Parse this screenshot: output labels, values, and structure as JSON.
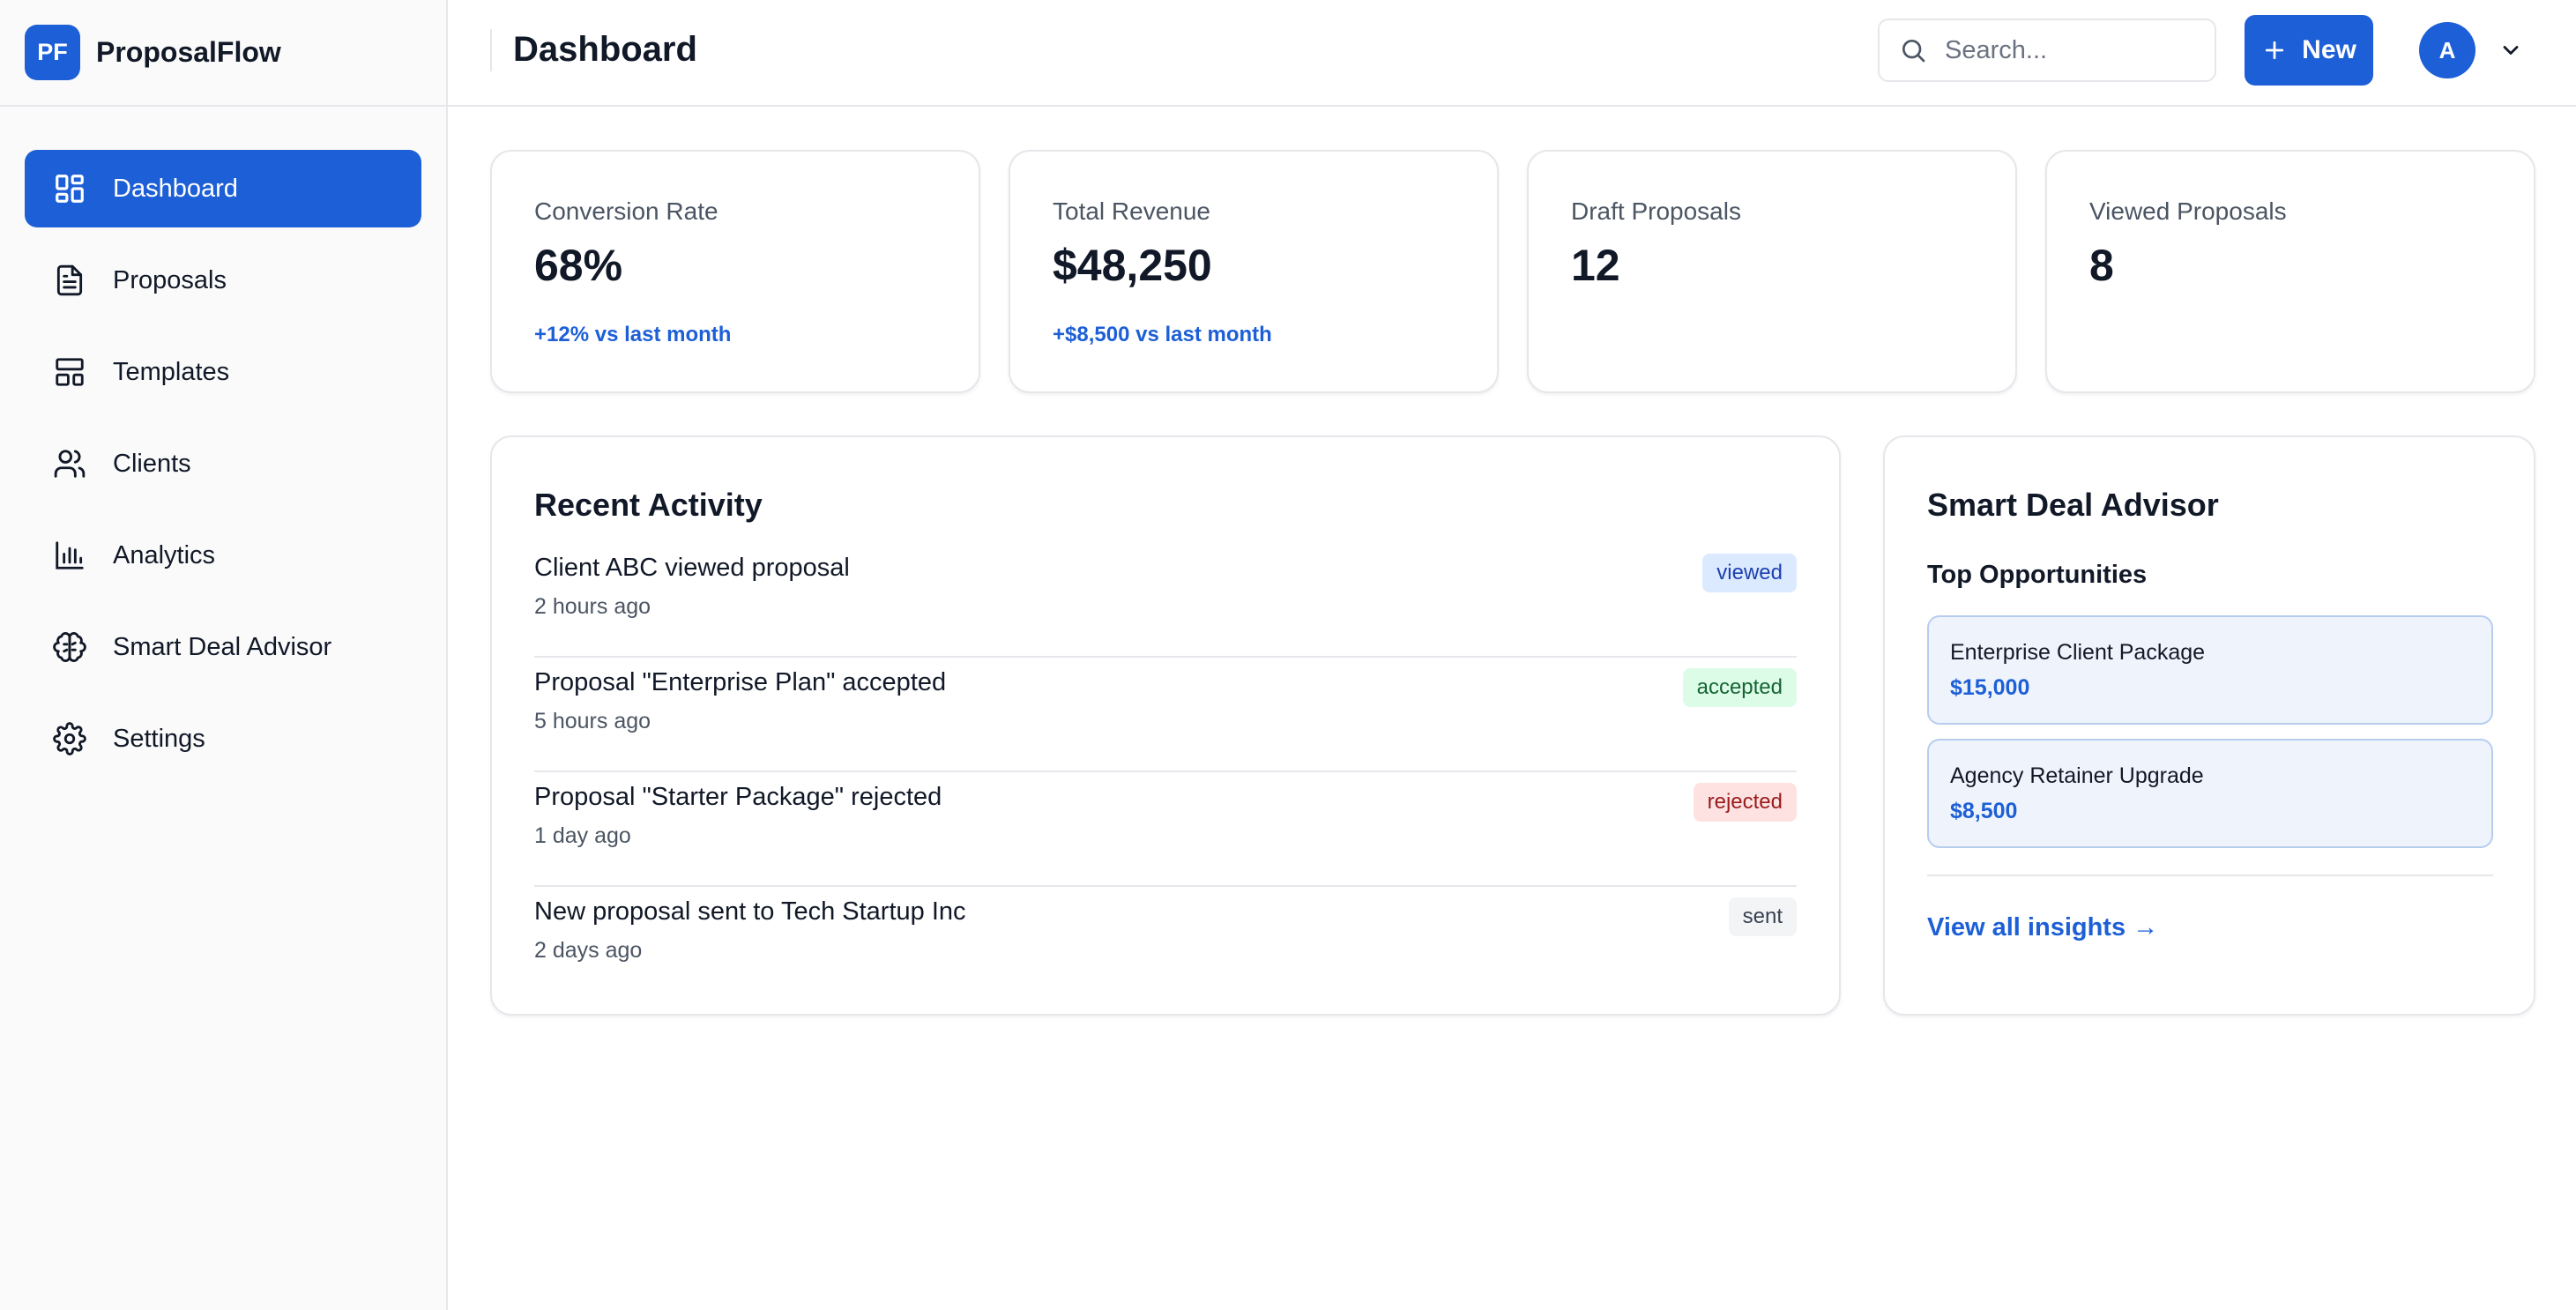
{
  "brand": {
    "logo_text": "PF",
    "name": "ProposalFlow"
  },
  "colors": {
    "accent": "#1d5fd6",
    "sidebar_bg": "#fafafa",
    "border": "#e5e7eb"
  },
  "sidebar": {
    "items": [
      {
        "label": "Dashboard",
        "icon": "dashboard-grid-icon",
        "active": true
      },
      {
        "label": "Proposals",
        "icon": "document-icon",
        "active": false
      },
      {
        "label": "Templates",
        "icon": "template-layout-icon",
        "active": false
      },
      {
        "label": "Clients",
        "icon": "users-icon",
        "active": false
      },
      {
        "label": "Analytics",
        "icon": "bar-chart-icon",
        "active": false
      },
      {
        "label": "Smart Deal Advisor",
        "icon": "brain-icon",
        "active": false
      },
      {
        "label": "Settings",
        "icon": "gear-icon",
        "active": false
      }
    ]
  },
  "header": {
    "title": "Dashboard",
    "search": {
      "placeholder": "Search...",
      "value": ""
    },
    "new_button": "New",
    "avatar_initial": "A"
  },
  "stats": [
    {
      "label": "Conversion Rate",
      "value": "68%",
      "trend": "+12% vs last month"
    },
    {
      "label": "Total Revenue",
      "value": "$48,250",
      "trend": "+$8,500 vs last month"
    },
    {
      "label": "Draft Proposals",
      "value": "12",
      "trend": ""
    },
    {
      "label": "Viewed Proposals",
      "value": "8",
      "trend": ""
    }
  ],
  "activity": {
    "title": "Recent Activity",
    "items": [
      {
        "text": "Client ABC viewed proposal",
        "time": "2 hours ago",
        "status": "viewed"
      },
      {
        "text": "Proposal \"Enterprise Plan\" accepted",
        "time": "5 hours ago",
        "status": "accepted"
      },
      {
        "text": "Proposal \"Starter Package\" rejected",
        "time": "1 day ago",
        "status": "rejected"
      },
      {
        "text": "New proposal sent to Tech Startup Inc",
        "time": "2 days ago",
        "status": "sent"
      }
    ]
  },
  "advisor": {
    "title": "Smart Deal Advisor",
    "subtitle": "Top Opportunities",
    "opportunities": [
      {
        "name": "Enterprise Client Package",
        "value": "$15,000"
      },
      {
        "name": "Agency Retainer Upgrade",
        "value": "$8,500"
      }
    ],
    "view_all": "View all insights →"
  }
}
